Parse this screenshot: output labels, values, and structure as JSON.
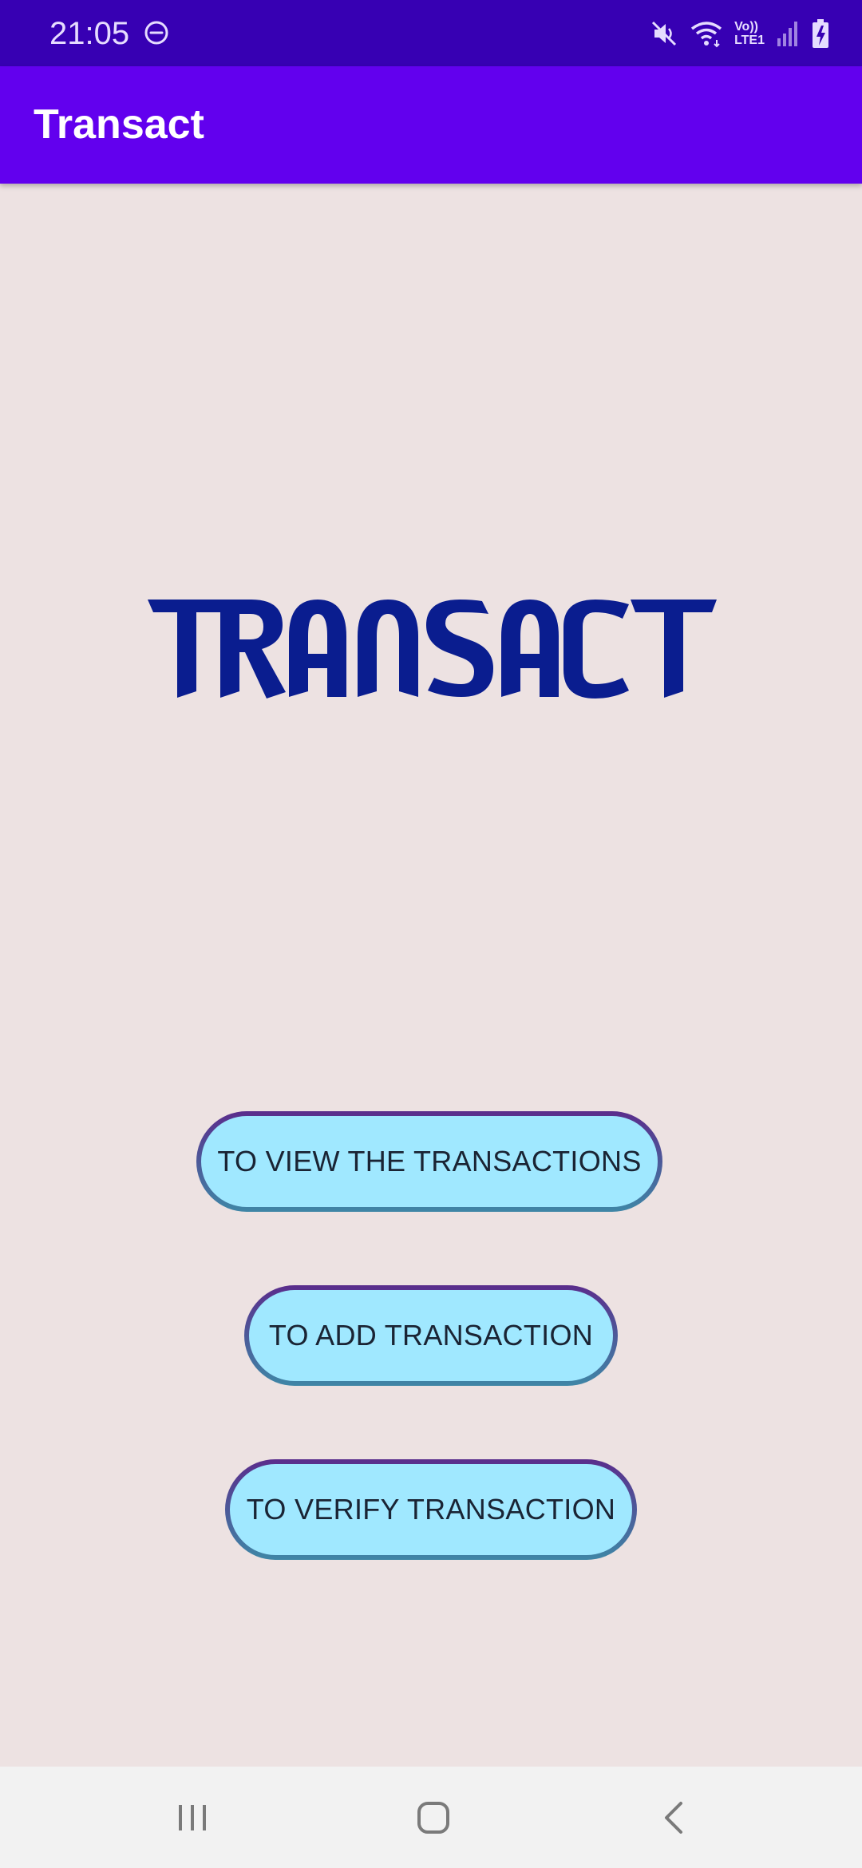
{
  "status_bar": {
    "time": "21:05",
    "volte_line1": "Vo))",
    "volte_line2": "LTE1",
    "icons": [
      "do-not-disturb-icon",
      "mute-icon",
      "wifi-icon",
      "volte-indicator",
      "signal-icon",
      "battery-charging-icon"
    ]
  },
  "app_bar": {
    "title": "Transact"
  },
  "logo": {
    "text": "TRANSACT",
    "color": "#0a1d8f"
  },
  "buttons": {
    "view_label": "TO VIEW THE TRANSACTIONS",
    "add_label": "TO ADD TRANSACTION",
    "verify_label": "TO VERIFY TRANSACTION"
  },
  "nav_bar": {
    "icons": [
      "recents-icon",
      "home-icon",
      "back-icon"
    ]
  },
  "colors": {
    "status_bar": "#3700b3",
    "app_bar": "#6200ee",
    "background": "#ede2e2",
    "button_fill": "#a0e8ff",
    "button_border_top": "#5a2d8c",
    "button_border_bottom": "#3f86a6"
  }
}
